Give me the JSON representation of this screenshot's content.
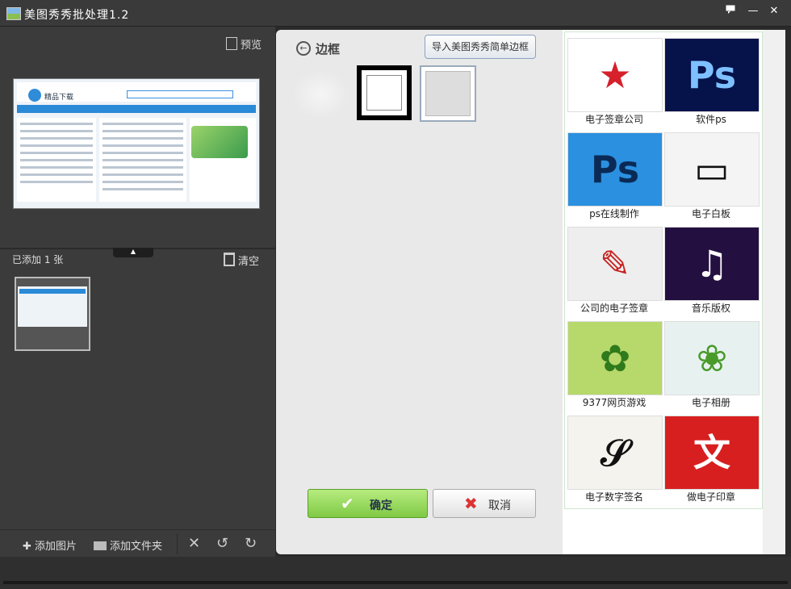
{
  "window": {
    "title": "美图秀秀批处理1.2",
    "menu_icon": "menu-chat-icon",
    "minimize": "—",
    "close": "✕"
  },
  "left": {
    "preview_label": "预览",
    "added_label": "已添加 1 张",
    "clear_label": "清空",
    "preview_site": {
      "logo_text": "精品下载"
    },
    "toolbar": {
      "add_image": "添加图片",
      "add_folder": "添加文件夹"
    }
  },
  "center": {
    "title": "边框",
    "import_button": "导入美图秀秀简单边框",
    "ok_button": "确定",
    "cancel_button": "取消"
  },
  "ads": [
    {
      "label": "电子签章公司",
      "glyph": "★",
      "color": "#d6202b",
      "bg": "#ffffff"
    },
    {
      "label": "软件ps",
      "glyph": "Ps",
      "color": "#7ec0ff",
      "bg": "#06124a"
    },
    {
      "label": "ps在线制作",
      "glyph": "Ps",
      "color": "#0a2a55",
      "bg": "#2b90e0"
    },
    {
      "label": "电子白板",
      "glyph": "▭",
      "color": "#111111",
      "bg": "#f4f4f4"
    },
    {
      "label": "公司的电子签章",
      "glyph": "✎",
      "color": "#c81e1e",
      "bg": "#eeeeee"
    },
    {
      "label": "音乐版权",
      "glyph": "♫",
      "color": "#ffffff",
      "bg": "#231040"
    },
    {
      "label": "9377网页游戏",
      "glyph": "✿",
      "color": "#2f7a1c",
      "bg": "#b7d86a"
    },
    {
      "label": "电子相册",
      "glyph": "❀",
      "color": "#4a9a2a",
      "bg": "#e7f2f0"
    },
    {
      "label": "电子数字签名",
      "glyph": "𝒮",
      "color": "#111111",
      "bg": "#f5f3ee"
    },
    {
      "label": "做电子印章",
      "glyph": "文",
      "color": "#ffffff",
      "bg": "#d81f1f"
    }
  ]
}
